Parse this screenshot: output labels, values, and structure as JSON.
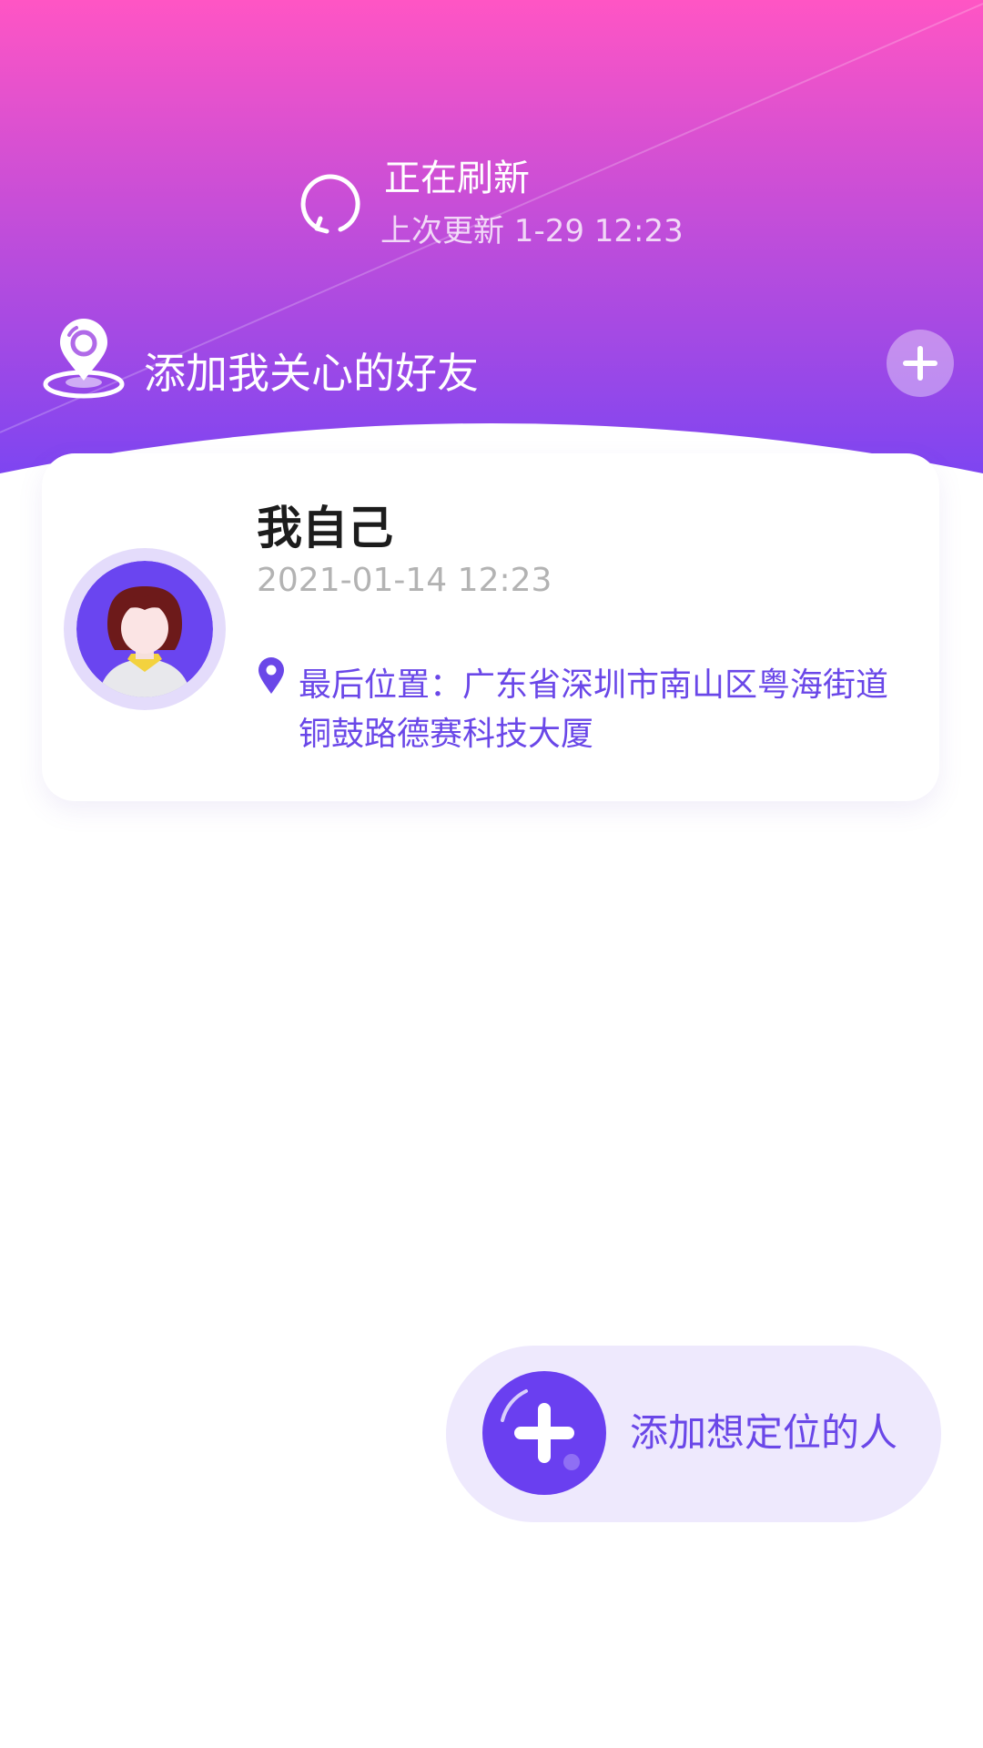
{
  "theme": {
    "gradient_top": "#ff55c4",
    "gradient_bottom": "#7e45f1",
    "accent": "#6a47e8",
    "fab_bg": "#eee9fd"
  },
  "refresh": {
    "icon": "refresh-icon",
    "title": "正在刷新",
    "last_update": "上次更新 1-29 12:23"
  },
  "friends_bar": {
    "icon": "location-pin-icon",
    "label": "添加我关心的好友",
    "add_icon": "plus-icon"
  },
  "card": {
    "avatar_icon": "user-avatar",
    "name": "我自己",
    "time": "2021-01-14  12:23",
    "location_icon": "map-pin-icon",
    "location": "最后位置：广东省深圳市南山区粤海街道铜鼓路德赛科技大厦"
  },
  "fab": {
    "icon": "plus-circle-icon",
    "label": "添加想定位的人"
  }
}
